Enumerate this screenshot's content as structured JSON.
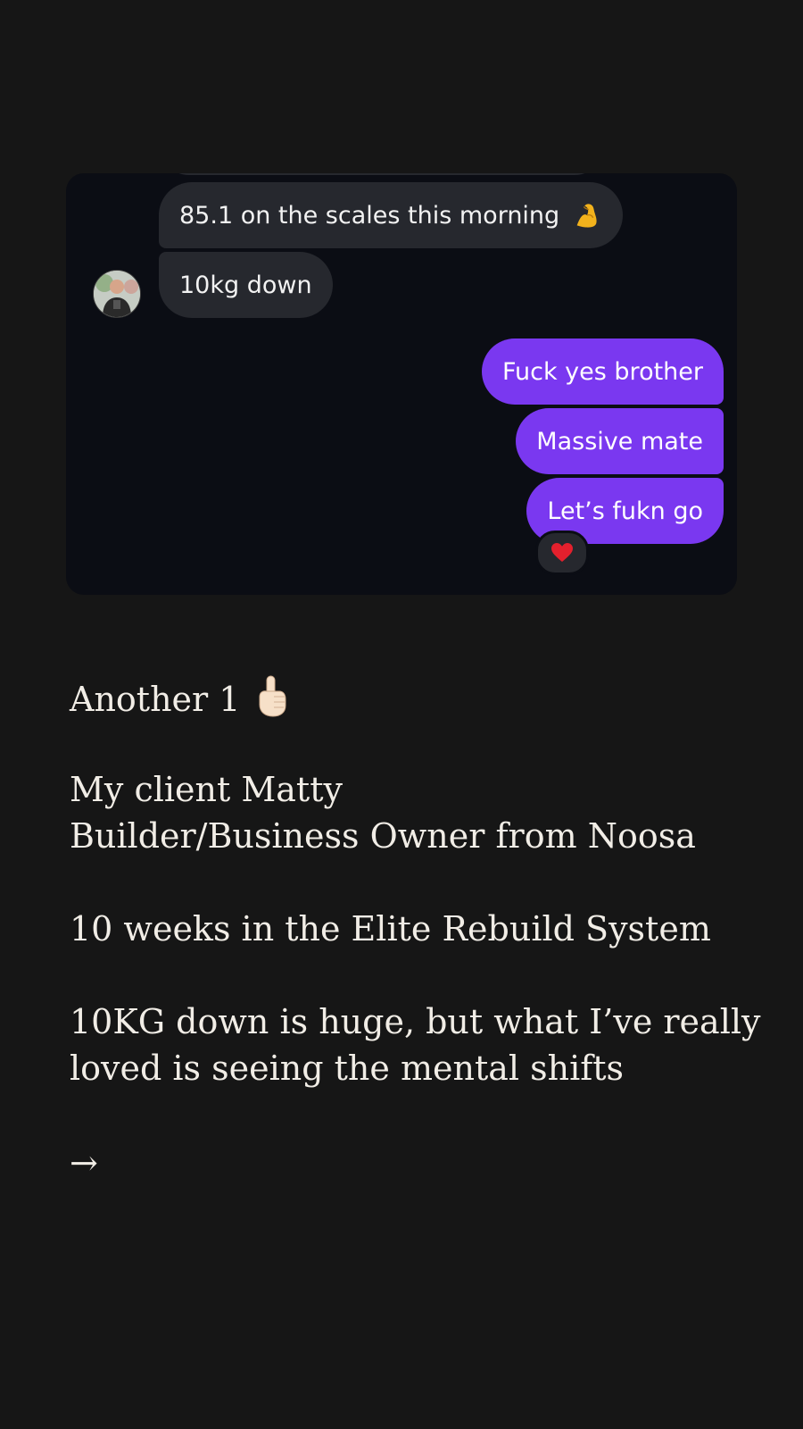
{
  "chat": {
    "incoming": [
      "85.1 on the scales this morning",
      "10kg down"
    ],
    "outgoing": [
      "Fuck yes brother",
      "Massive mate",
      "Let’s fukn go"
    ],
    "reaction": "❤️",
    "icons": {
      "incoming_emoji": "flexed-biceps-icon",
      "reaction": "heart-icon"
    }
  },
  "caption": {
    "line1": "Another 1",
    "line2": "My client Matty",
    "line3": "Builder/Business Owner from Noosa",
    "line4": "10 weeks in the Elite Rebuild System",
    "line5": "10KG down is huge, but what I’ve really",
    "line6": "loved is seeing the mental shifts",
    "arrow": "→"
  },
  "colors": {
    "page_bg": "#161616",
    "chat_bg": "#0b0d14",
    "incoming_bubble": "#26282e",
    "outgoing_bubble": "#7a38f0",
    "caption_text": "#f1ede6"
  }
}
